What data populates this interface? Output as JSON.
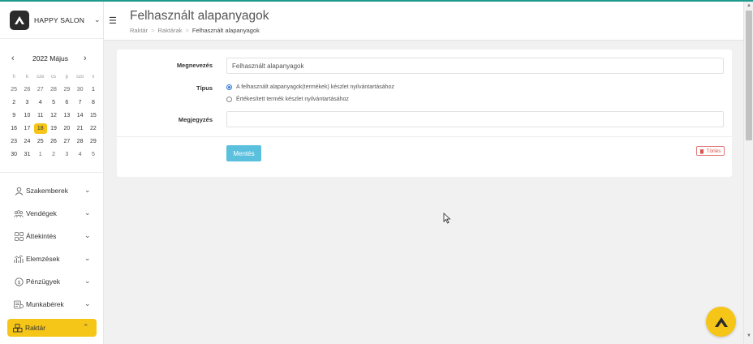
{
  "brand": {
    "name": "HAPPY SALON"
  },
  "calendar": {
    "title": "2022 Május",
    "weekdays": [
      "h",
      "k",
      "sze",
      "cs",
      "p",
      "szo",
      "v"
    ],
    "days": [
      {
        "d": "25",
        "muted": true
      },
      {
        "d": "26",
        "muted": true
      },
      {
        "d": "27",
        "muted": true
      },
      {
        "d": "28",
        "muted": true
      },
      {
        "d": "29",
        "muted": true
      },
      {
        "d": "30",
        "muted": true
      },
      {
        "d": "1"
      },
      {
        "d": "2"
      },
      {
        "d": "3"
      },
      {
        "d": "4"
      },
      {
        "d": "5"
      },
      {
        "d": "6"
      },
      {
        "d": "7"
      },
      {
        "d": "8"
      },
      {
        "d": "9"
      },
      {
        "d": "10"
      },
      {
        "d": "11"
      },
      {
        "d": "12"
      },
      {
        "d": "13"
      },
      {
        "d": "14"
      },
      {
        "d": "15"
      },
      {
        "d": "16"
      },
      {
        "d": "17"
      },
      {
        "d": "18",
        "today": true
      },
      {
        "d": "19"
      },
      {
        "d": "20"
      },
      {
        "d": "21"
      },
      {
        "d": "22"
      },
      {
        "d": "23"
      },
      {
        "d": "24"
      },
      {
        "d": "25"
      },
      {
        "d": "26"
      },
      {
        "d": "27"
      },
      {
        "d": "28"
      },
      {
        "d": "29"
      },
      {
        "d": "30"
      },
      {
        "d": "31"
      },
      {
        "d": "1",
        "muted": true
      },
      {
        "d": "2",
        "muted": true
      },
      {
        "d": "3",
        "muted": true
      },
      {
        "d": "4",
        "muted": true
      },
      {
        "d": "5",
        "muted": true
      }
    ]
  },
  "nav": {
    "items": [
      {
        "label": "Szakemberek",
        "icon": "user-icon"
      },
      {
        "label": "Vendégek",
        "icon": "users-icon"
      },
      {
        "label": "Áttekintés",
        "icon": "grid-icon"
      },
      {
        "label": "Elemzések",
        "icon": "chart-icon"
      },
      {
        "label": "Pénzügyek",
        "icon": "coin-icon"
      },
      {
        "label": "Munkabérek",
        "icon": "payroll-icon"
      },
      {
        "label": "Raktár",
        "icon": "boxes-icon",
        "active": true
      }
    ]
  },
  "header": {
    "title": "Felhasznált alapanyagok",
    "breadcrumb": [
      "Raktár",
      "Raktárak",
      "Felhasznált alapanyagok"
    ]
  },
  "form": {
    "name_label": "Megnevezés",
    "name_value": "Felhasznált alapanyagok",
    "type_label": "Típus",
    "type_options": [
      "A felhasznált alapanyagok(termékek) készlet nyilvántartásához",
      "Értékesített termék készlet nyilvántartásához"
    ],
    "type_selected": 0,
    "note_label": "Megjegyzés",
    "note_value": "",
    "save_label": "Mentés",
    "delete_label": "Törlés"
  },
  "colors": {
    "accent": "#f5c518",
    "info": "#5bc0de",
    "danger": "#d9534f",
    "topline": "#1f9a8f"
  }
}
